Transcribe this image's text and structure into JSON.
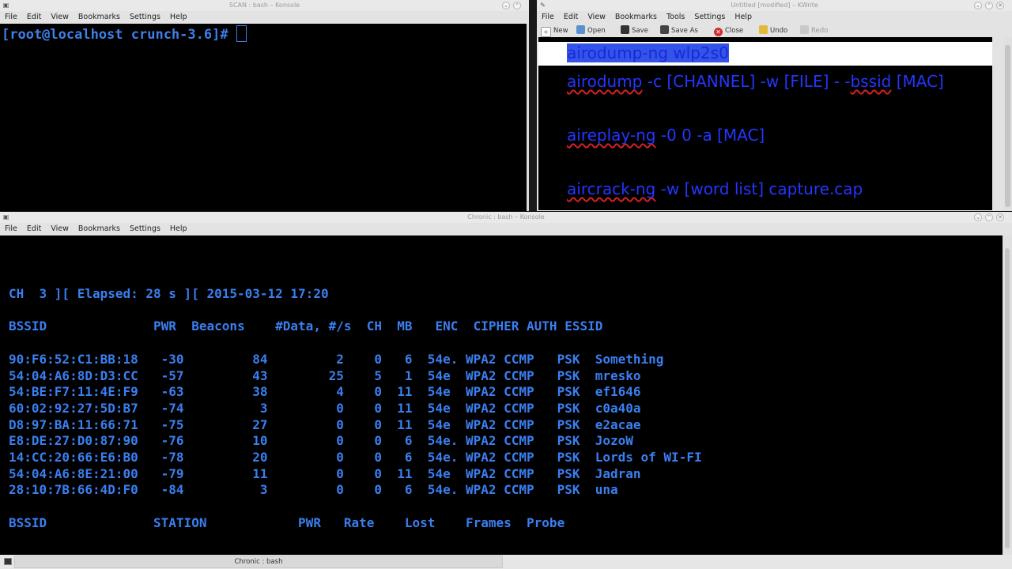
{
  "scan_window": {
    "title": "SCAN : bash – Konsole",
    "menu": [
      "File",
      "Edit",
      "View",
      "Bookmarks",
      "Settings",
      "Help"
    ],
    "prompt": "[root@localhost crunch-3.6]# "
  },
  "kwrite_window": {
    "title": "Untitled [modified] – KWrite",
    "menu": [
      "File",
      "Edit",
      "View",
      "Bookmarks",
      "Tools",
      "Settings",
      "Help"
    ],
    "toolbar": {
      "new": "New",
      "open": "Open",
      "save": "Save",
      "save_as": "Save As",
      "close": "Close",
      "undo": "Undo",
      "redo": "Redo"
    },
    "lines": {
      "l1_a": "airodump-ng wlp2s0",
      "l2_a": "airodump",
      "l2_b": " -c  [CHANNEL]  -w [FILE] - -",
      "l2_c": "bssid",
      "l2_d": " [MAC]",
      "l3_a": "aireplay-ng",
      "l3_b": " -0 0 -a [MAC]",
      "l4_a": "aircrack-ng",
      "l4_b": " -w [word list] capture.cap"
    }
  },
  "chronic_window": {
    "title": "Chronic : bash – Konsole",
    "menu": [
      "File",
      "Edit",
      "View",
      "Bookmarks",
      "Settings",
      "Help"
    ],
    "status_line": "CH  3 ][ Elapsed: 28 s ][ 2015-03-12 17:20",
    "ap_header": "BSSID              PWR  Beacons    #Data, #/s  CH  MB   ENC  CIPHER AUTH ESSID",
    "ap_rows": [
      {
        "bssid": "90:F6:52:C1:BB:18",
        "pwr": "-30",
        "beacons": "84",
        "data": "2",
        "per_s": "0",
        "ch": "6",
        "mb": "54e.",
        "enc": "WPA2",
        "cipher": "CCMP",
        "auth": "PSK",
        "essid": "Something"
      },
      {
        "bssid": "54:04:A6:8D:D3:CC",
        "pwr": "-57",
        "beacons": "43",
        "data": "25",
        "per_s": "5",
        "ch": "1",
        "mb": "54e",
        "enc": "WPA2",
        "cipher": "CCMP",
        "auth": "PSK",
        "essid": "mresko"
      },
      {
        "bssid": "54:BE:F7:11:4E:F9",
        "pwr": "-63",
        "beacons": "38",
        "data": "4",
        "per_s": "0",
        "ch": "11",
        "mb": "54e",
        "enc": "WPA2",
        "cipher": "CCMP",
        "auth": "PSK",
        "essid": "ef1646"
      },
      {
        "bssid": "60:02:92:27:5D:B7",
        "pwr": "-74",
        "beacons": "3",
        "data": "0",
        "per_s": "0",
        "ch": "11",
        "mb": "54e",
        "enc": "WPA2",
        "cipher": "CCMP",
        "auth": "PSK",
        "essid": "c0a40a"
      },
      {
        "bssid": "D8:97:BA:11:66:71",
        "pwr": "-75",
        "beacons": "27",
        "data": "0",
        "per_s": "0",
        "ch": "11",
        "mb": "54e",
        "enc": "WPA2",
        "cipher": "CCMP",
        "auth": "PSK",
        "essid": "e2acae"
      },
      {
        "bssid": "E8:DE:27:D0:87:90",
        "pwr": "-76",
        "beacons": "10",
        "data": "0",
        "per_s": "0",
        "ch": "6",
        "mb": "54e.",
        "enc": "WPA2",
        "cipher": "CCMP",
        "auth": "PSK",
        "essid": "JozoW"
      },
      {
        "bssid": "14:CC:20:66:E6:B0",
        "pwr": "-78",
        "beacons": "20",
        "data": "0",
        "per_s": "0",
        "ch": "6",
        "mb": "54e.",
        "enc": "WPA2",
        "cipher": "CCMP",
        "auth": "PSK",
        "essid": "Lords of WI-FI"
      },
      {
        "bssid": "54:04:A6:8E:21:00",
        "pwr": "-79",
        "beacons": "11",
        "data": "0",
        "per_s": "0",
        "ch": "11",
        "mb": "54e",
        "enc": "WPA2",
        "cipher": "CCMP",
        "auth": "PSK",
        "essid": "Jadran"
      },
      {
        "bssid": "28:10:7B:66:4D:F0",
        "pwr": "-84",
        "beacons": "3",
        "data": "0",
        "per_s": "0",
        "ch": "6",
        "mb": "54e.",
        "enc": "WPA2",
        "cipher": "CCMP",
        "auth": "PSK",
        "essid": "una"
      }
    ],
    "station_header": "BSSID              STATION            PWR   Rate    Lost    Frames  Probe"
  },
  "taskbar": {
    "item_label": "Chronic : bash"
  },
  "colors": {
    "terminal_text": "#3a7ff0",
    "editor_text": "#2336ff",
    "window_chrome": "#e3e3e3"
  }
}
